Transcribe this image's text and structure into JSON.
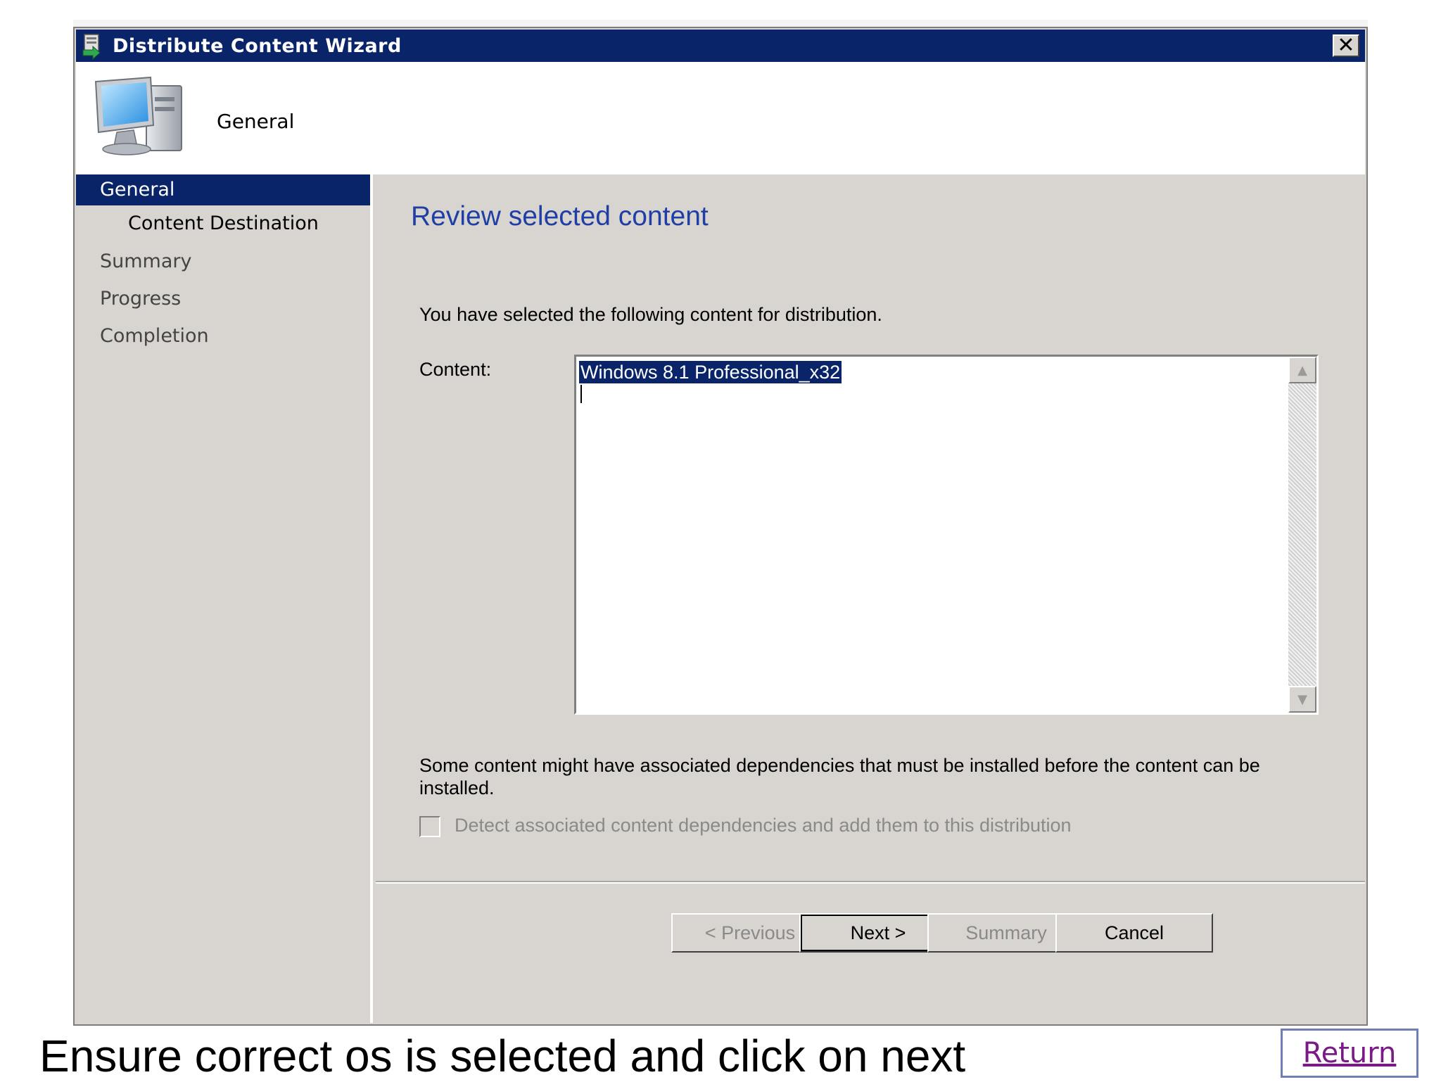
{
  "window": {
    "title": "Distribute Content Wizard"
  },
  "header": {
    "title": "General"
  },
  "nav": {
    "items": [
      {
        "label": "General",
        "active": true
      },
      {
        "label": "Content Destination",
        "sub": true
      },
      {
        "label": "Summary"
      },
      {
        "label": "Progress"
      },
      {
        "label": "Completion"
      }
    ]
  },
  "main": {
    "heading": "Review selected content",
    "intro": "You have selected the following content for distribution.",
    "content_label": "Content:",
    "content_items": [
      "Windows 8.1 Professional_x32"
    ],
    "dependency_text": "Some content might have associated dependencies that must be installed before the content can be installed.",
    "dependency_checkbox_label": "Detect associated content dependencies and add them to this distribution",
    "dependency_checked": false
  },
  "buttons": {
    "previous": "< Previous",
    "next": "Next >",
    "summary": "Summary",
    "cancel": "Cancel"
  },
  "caption": "Ensure correct os is selected and click on next",
  "return_link": "Return",
  "colors": {
    "titlebar": "#0a246a",
    "heading": "#1f3fa6",
    "window_bg": "#d8d4cf"
  }
}
